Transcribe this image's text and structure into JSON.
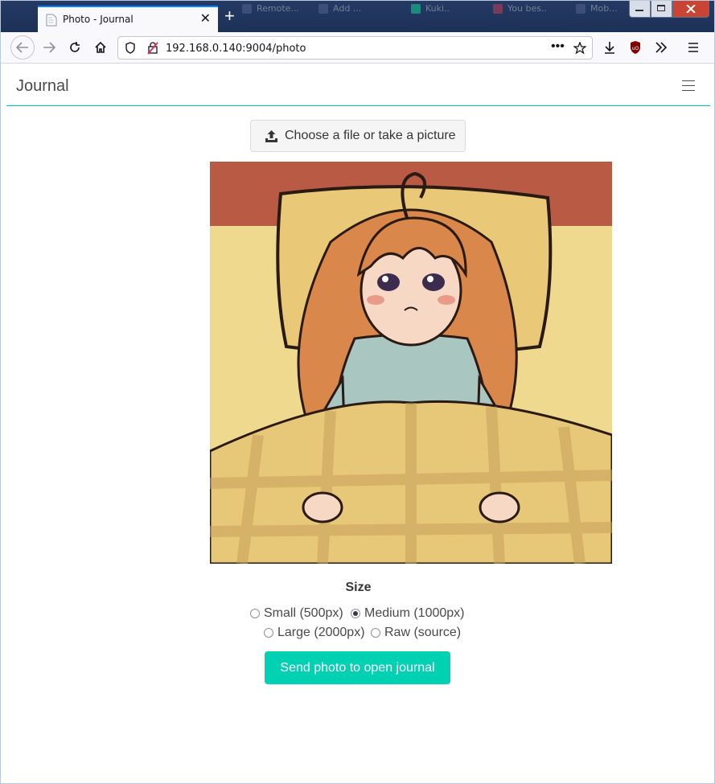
{
  "browser": {
    "tab_title": "Photo - Journal",
    "url": "192.168.0.140:9004/photo",
    "background_tabs": [
      "Remote...",
      "Add ...",
      "Kuki..",
      "You bes..",
      "Mob..."
    ],
    "icons": {
      "back": "arrow-left-icon",
      "forward": "arrow-right-icon",
      "reload": "reload-icon",
      "home": "home-icon",
      "shield": "shield-icon",
      "insecure": "insecure-lock-icon",
      "more": "more-dots-icon",
      "bookmark": "star-icon",
      "downloads": "download-icon",
      "ublock": "ublock-icon",
      "overflow": "chevron-double-right-icon",
      "menu": "hamburger-menu-icon"
    }
  },
  "navbar": {
    "brand": "Journal",
    "menu_icon": "hamburger-menu-icon"
  },
  "upload": {
    "label": "Choose a file or take a picture",
    "icon": "upload-icon"
  },
  "photo": {
    "description_icon": "anime-girl-in-bed-image"
  },
  "size": {
    "label": "Size",
    "options": [
      {
        "label": "Small (500px)",
        "selected": false
      },
      {
        "label": "Medium (1000px)",
        "selected": true
      },
      {
        "label": "Large (2000px)",
        "selected": false
      },
      {
        "label": "Raw (source)",
        "selected": false
      }
    ]
  },
  "send_button": {
    "label": "Send photo to open journal"
  },
  "colors": {
    "accent": "#00d1b2",
    "navbar_border": "#00c4a7",
    "tab_accent": "#0a84ff"
  }
}
